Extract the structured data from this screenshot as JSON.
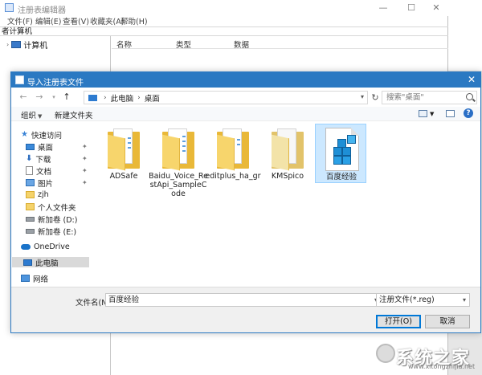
{
  "regedit": {
    "title": "注册表编辑器",
    "menu": [
      "文件(F)",
      "编辑(E)",
      "查看(V)",
      "收藏夹(A)",
      "帮助(H)"
    ],
    "address_text": "者计算机",
    "tree_root": "计算机",
    "columns": [
      "名称",
      "类型",
      "数据"
    ]
  },
  "dialog": {
    "title": "导入注册表文件",
    "breadcrumb": [
      "此电脑",
      "桌面"
    ],
    "search_placeholder": "搜索\"桌面\"",
    "commands": {
      "organize": "组织",
      "new_folder": "新建文件夹"
    },
    "nav": {
      "quick_access": "快速访问",
      "items": [
        {
          "label": "桌面",
          "icon": "desktop-icon",
          "pinned": true
        },
        {
          "label": "下载",
          "icon": "download-icon",
          "pinned": true
        },
        {
          "label": "文档",
          "icon": "document-icon",
          "pinned": true
        },
        {
          "label": "图片",
          "icon": "pictures-icon",
          "pinned": true
        },
        {
          "label": "zjh",
          "icon": "folder-icon",
          "pinned": false
        },
        {
          "label": "个人文件夹",
          "icon": "folder-icon",
          "pinned": false
        },
        {
          "label": "新加卷 (D:)",
          "icon": "drive-icon",
          "pinned": false
        },
        {
          "label": "新加卷 (E:)",
          "icon": "drive-icon",
          "pinned": false
        }
      ],
      "onedrive": "OneDrive",
      "this_pc": "此电脑",
      "network": "网络"
    },
    "files": [
      {
        "label": "ADSafe",
        "type": "folder"
      },
      {
        "label": "Baidu_Voice_RestApi_SampleCode",
        "type": "folder"
      },
      {
        "label": "editplus_ha_gr",
        "type": "folder"
      },
      {
        "label": "KMSpico",
        "type": "folder"
      },
      {
        "label": "百度经验",
        "type": "reg-file",
        "selected": true
      }
    ],
    "filename_label": "文件名(N):",
    "filename_value": "百度经验",
    "filetype_value": "注册文件(*.reg)",
    "open_button": "打开(O)",
    "cancel_button": "取消"
  },
  "watermark": {
    "text": "系统之家",
    "url": "www.xitongzhijia.net"
  },
  "colors": {
    "title_blue": "#2b79c2",
    "selection": "#cce8ff",
    "folder_yellow": "#f7d56c"
  }
}
